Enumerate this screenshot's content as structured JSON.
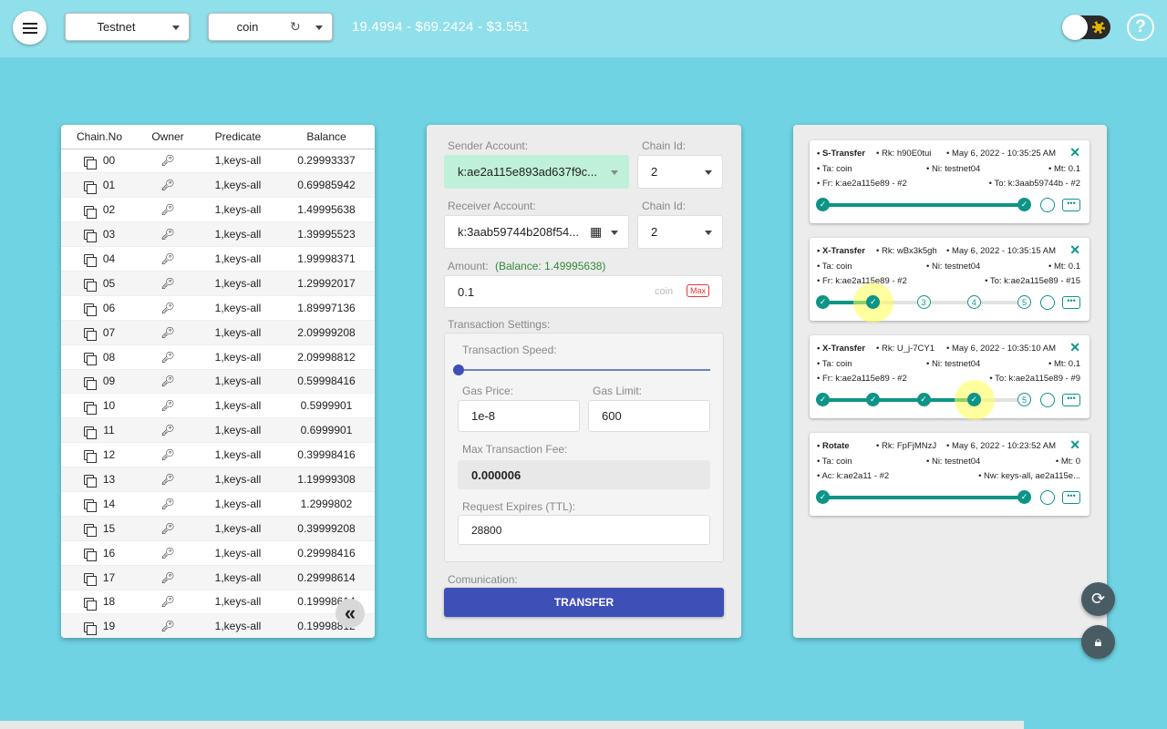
{
  "header": {
    "menu_icon": "hamburger-icon",
    "network": "Testnet",
    "token": "coin",
    "price_line": "19.4994 - $69.2424 - $3.551",
    "help_label": "?"
  },
  "chains": {
    "columns": [
      "Chain.No",
      "Owner",
      "Predicate",
      "Balance"
    ],
    "rows": [
      {
        "no": "00",
        "predicate": "1,keys-all",
        "balance": "0.29993337"
      },
      {
        "no": "01",
        "predicate": "1,keys-all",
        "balance": "0.69985942"
      },
      {
        "no": "02",
        "predicate": "1,keys-all",
        "balance": "1.49995638"
      },
      {
        "no": "03",
        "predicate": "1,keys-all",
        "balance": "1.39995523"
      },
      {
        "no": "04",
        "predicate": "1,keys-all",
        "balance": "1.99998371"
      },
      {
        "no": "05",
        "predicate": "1,keys-all",
        "balance": "1.29992017"
      },
      {
        "no": "06",
        "predicate": "1,keys-all",
        "balance": "1.89997136"
      },
      {
        "no": "07",
        "predicate": "1,keys-all",
        "balance": "2.09999208"
      },
      {
        "no": "08",
        "predicate": "1,keys-all",
        "balance": "2.09998812"
      },
      {
        "no": "09",
        "predicate": "1,keys-all",
        "balance": "0.59998416"
      },
      {
        "no": "10",
        "predicate": "1,keys-all",
        "balance": "0.5999901"
      },
      {
        "no": "11",
        "predicate": "1,keys-all",
        "balance": "0.6999901"
      },
      {
        "no": "12",
        "predicate": "1,keys-all",
        "balance": "0.39998416"
      },
      {
        "no": "13",
        "predicate": "1,keys-all",
        "balance": "1.19999308"
      },
      {
        "no": "14",
        "predicate": "1,keys-all",
        "balance": "1.2999802"
      },
      {
        "no": "15",
        "predicate": "1,keys-all",
        "balance": "0.39999208"
      },
      {
        "no": "16",
        "predicate": "1,keys-all",
        "balance": "0.29998416"
      },
      {
        "no": "17",
        "predicate": "1,keys-all",
        "balance": "0.29998614"
      },
      {
        "no": "18",
        "predicate": "1,keys-all",
        "balance": "0.19998614"
      },
      {
        "no": "19",
        "predicate": "1,keys-all",
        "balance": "0.19998812"
      }
    ],
    "collapse_label": "«"
  },
  "form": {
    "sender_label": "Sender Account:",
    "sender_value": "k:ae2a115e893ad637f9c...",
    "sender_chain_label": "Chain Id:",
    "sender_chain": "2",
    "receiver_label": "Receiver Account:",
    "receiver_value": "k:3aab59744b208f54...",
    "receiver_chain_label": "Chain Id:",
    "receiver_chain": "2",
    "amount_label": "Amount:",
    "balance_note": "(Balance: 1.49995638)",
    "amount_value": "0.1",
    "amount_unit": "coin",
    "max_label": "Max",
    "settings_label": "Transaction Settings:",
    "speed_label": "Transaction Speed:",
    "speed_level": 0,
    "gas_price_label": "Gas Price:",
    "gas_price": "1e-8",
    "gas_limit_label": "Gas Limit:",
    "gas_limit": "600",
    "max_fee_label": "Max Transaction Fee:",
    "max_fee": "0.000006",
    "ttl_label": "Request Expires (TTL):",
    "ttl": "28800",
    "comm_label": "Comunication:",
    "transfer_label": "TRANSFER"
  },
  "transactions": [
    {
      "type": "• S-Transfer",
      "rk": "• Rk: h90E0tui",
      "date": "• May 6, 2022 - 10:35:25 AM",
      "ta": "• Ta: coin",
      "ni": "• Ni: testnet04",
      "mt": "• Mt: 0.1",
      "left": "• Fr: k:ae2a115e89 - #2",
      "right": "• To: k:3aab59744b - #2",
      "progress": 1.0,
      "steps": []
    },
    {
      "type": "• X-Transfer",
      "rk": "• Rk: wBx3k5gh",
      "date": "• May 6, 2022 - 10:35:15 AM",
      "ta": "• Ta: coin",
      "ni": "• Ni: testnet04",
      "mt": "• Mt: 0.1",
      "left": "• Fr: k:ae2a115e89 - #2",
      "right": "• To: k:ae2a115e89 - #15",
      "progress": 0.25,
      "steps": [
        "3",
        "4",
        "5"
      ]
    },
    {
      "type": "• X-Transfer",
      "rk": "• Rk: U_j-7CY1",
      "date": "• May 6, 2022 - 10:35:10 AM",
      "ta": "• Ta: coin",
      "ni": "• Ni: testnet04",
      "mt": "• Mt: 0.1",
      "left": "• Fr: k:ae2a115e89 - #2",
      "right": "• To: k:ae2a115e89 - #9",
      "progress": 0.75,
      "steps": [
        "5"
      ]
    },
    {
      "type": "• Rotate",
      "rk": "• Rk: FpFjMNzJ",
      "date": "• May 6, 2022 - 10:23:52 AM",
      "ta": "• Ta: coin",
      "ni": "• Ni: testnet04",
      "mt": "• Mt: 0",
      "left": "• Ac: k:ae2a11 - #2",
      "right": "• Nw: keys-all, ae2a115e...",
      "progress": 1.0,
      "steps": []
    }
  ],
  "colors": {
    "accent": "#0d9486",
    "primary_button": "#3e4fb8",
    "background": "#6fd3e3"
  }
}
